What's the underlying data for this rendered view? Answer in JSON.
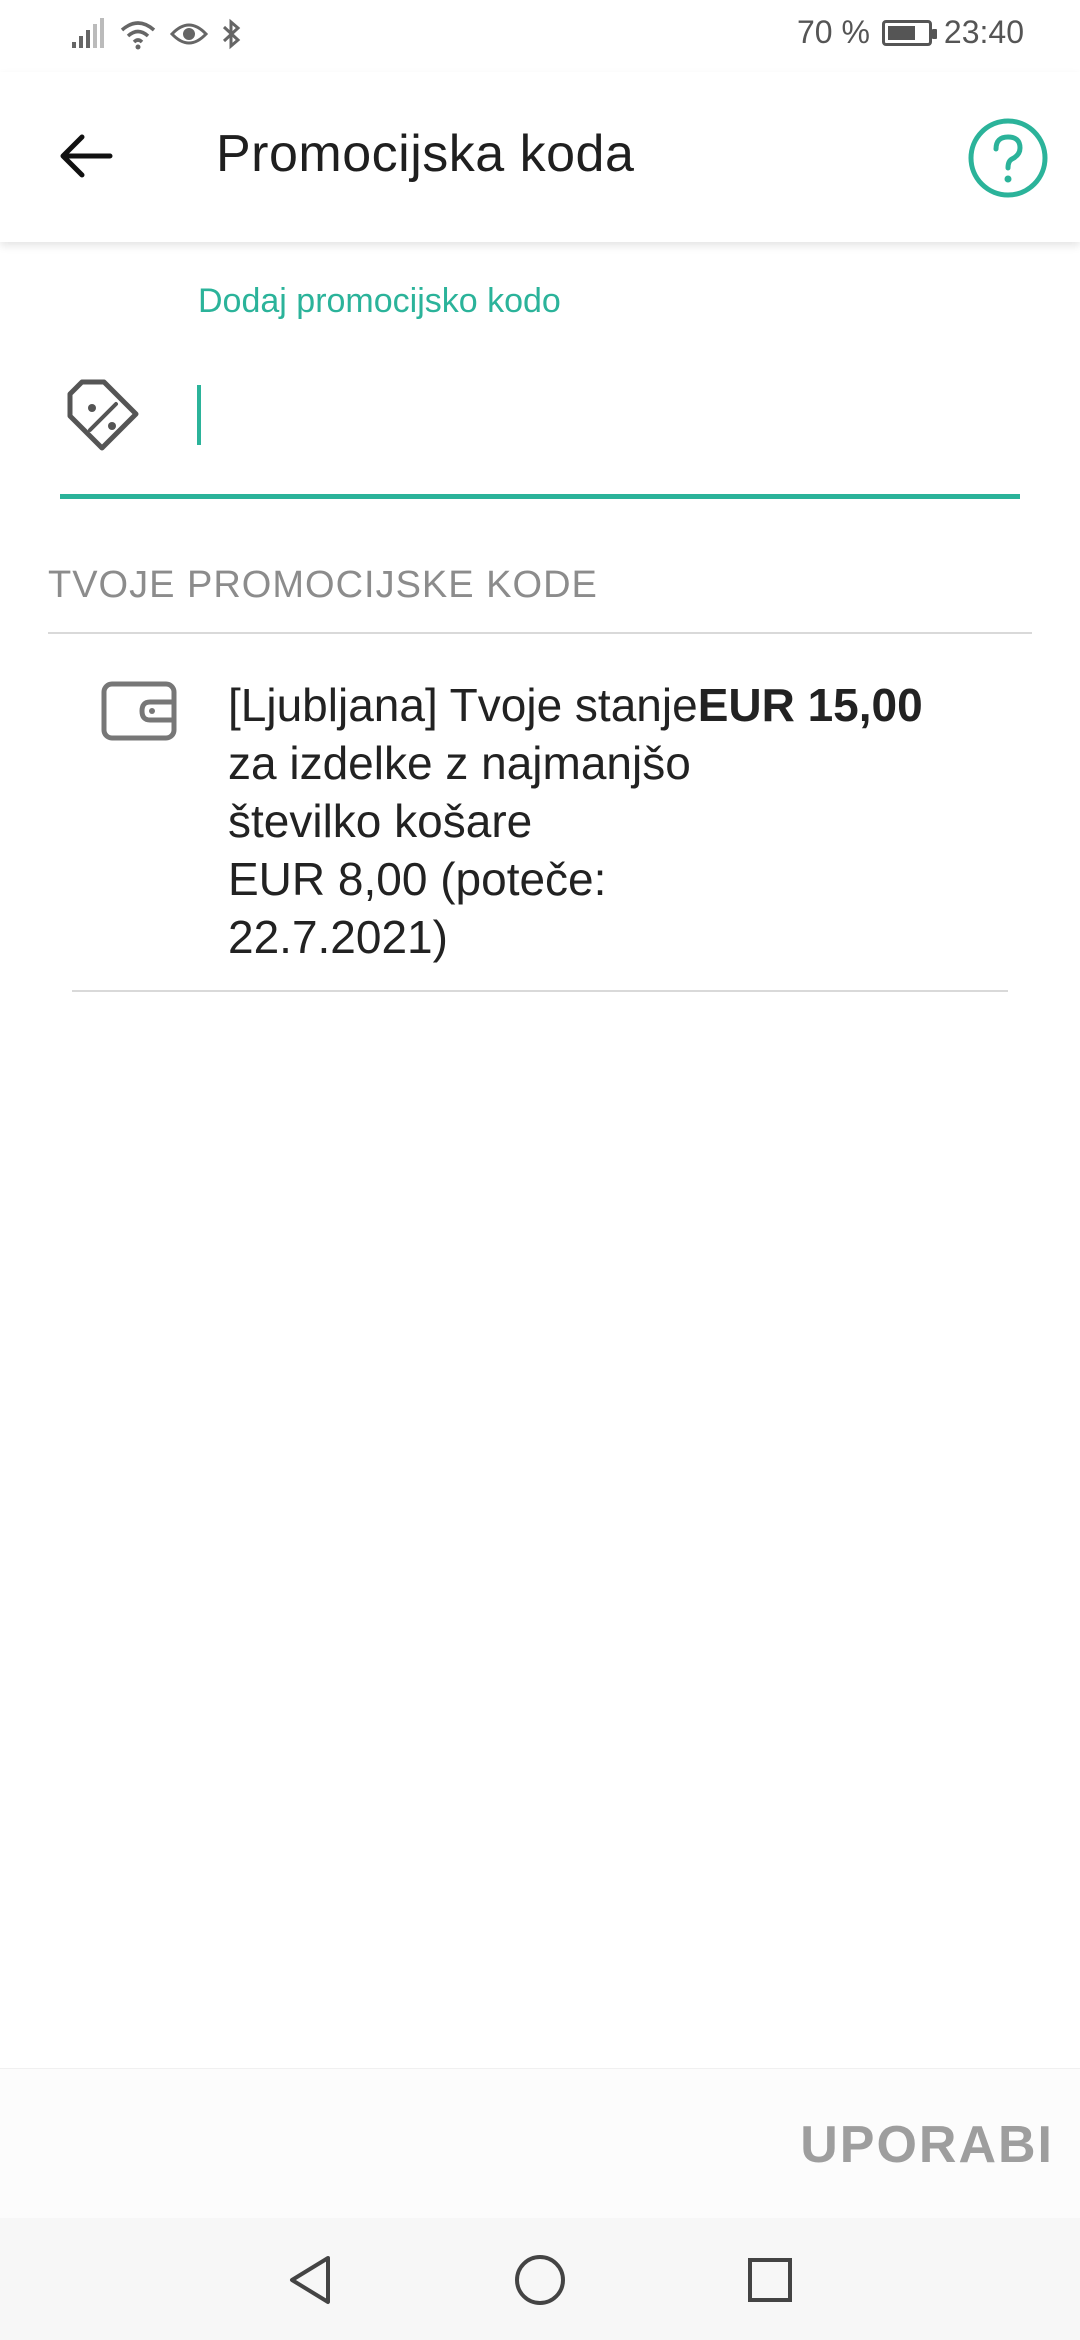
{
  "status_bar": {
    "battery_text": "70 %",
    "battery_level": 0.7,
    "time": "23:40"
  },
  "app_bar": {
    "title": "Promocijska koda",
    "back_icon": "arrow-left-icon",
    "help_icon": "help-circle-icon"
  },
  "promo_input": {
    "label": "Dodaj promocijsko kodo",
    "value": "",
    "placeholder": "",
    "icon": "tag-percent-icon"
  },
  "promo_codes": {
    "header": "TVOJE PROMOCIJSKE KODE",
    "items": [
      {
        "icon": "wallet-icon",
        "prefix": "[Ljubljana] Tvoje stanje",
        "amount": "EUR 15,00",
        "line2": "za izdelke z najmanjšo",
        "line3": "številko košare",
        "line4": "EUR 8,00 (poteče:",
        "line5": "22.7.2021)"
      }
    ]
  },
  "actions": {
    "apply_label": "UPORABI"
  },
  "colors": {
    "accent": "#2bb39a",
    "disabled": "#9e9e9e"
  }
}
